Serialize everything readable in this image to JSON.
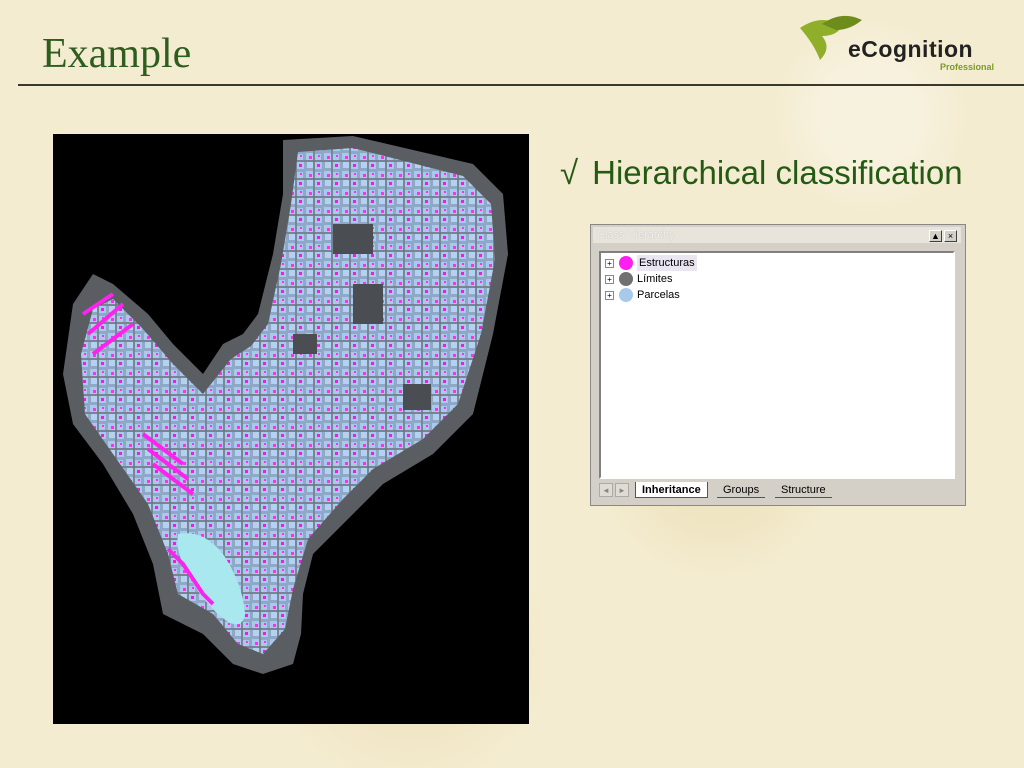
{
  "slide": {
    "title": "Example",
    "bullet_mark": "√",
    "bullet_text": "Hierarchical classification"
  },
  "logo": {
    "name": "eCognition",
    "subtitle": "Professional"
  },
  "window": {
    "title": "Class Hierarchy",
    "min_button": "▲",
    "close_button": "×",
    "classes": [
      {
        "label": "Estructuras",
        "color": "#ff1ef0"
      },
      {
        "label": "Límites",
        "color": "#707070"
      },
      {
        "label": "Parcelas",
        "color": "#a8c8ec"
      }
    ],
    "tab_left": "◄",
    "tab_right": "►",
    "tabs": [
      "Inheritance",
      "Groups",
      "Structure"
    ],
    "active_tab": "Inheritance"
  },
  "colors": {
    "title_green": "#2f5d1e",
    "bullet_green": "#245a14",
    "map_background": "#000000"
  }
}
